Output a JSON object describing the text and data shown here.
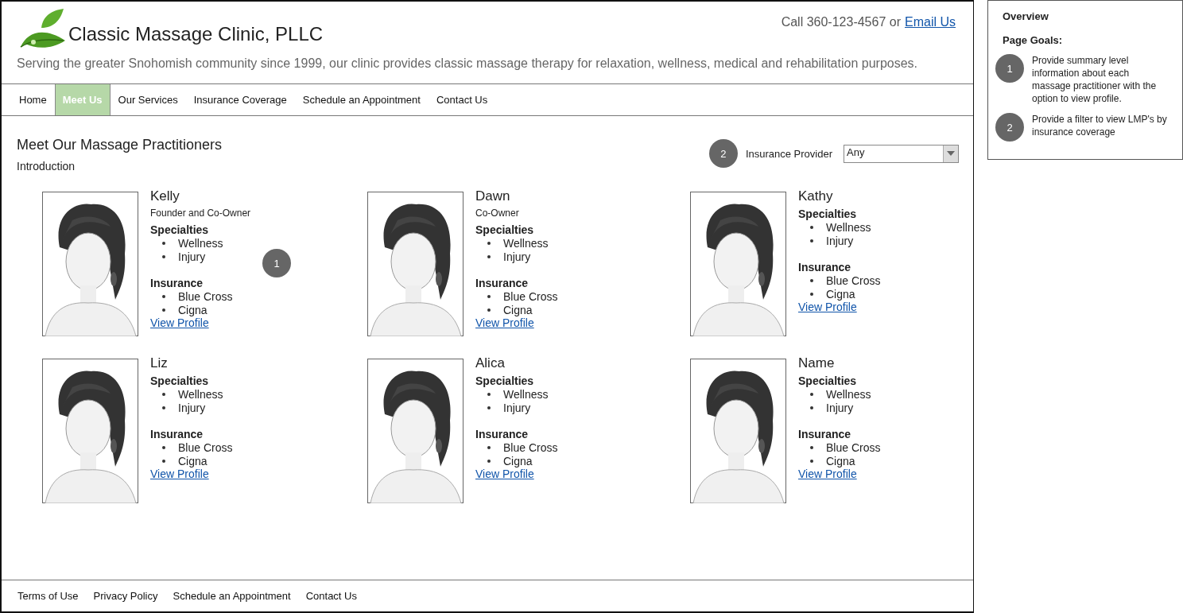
{
  "header": {
    "title": "Classic Massage Clinic, PLLC",
    "contact_text": "Call 360-123-4567 or",
    "contact_link": "Email Us",
    "tagline": "Serving the greater Snohomish community since 1999, our clinic provides classic massage therapy for relaxation, wellness, medical and rehabilitation purposes."
  },
  "nav": [
    {
      "label": "Home",
      "selected": false
    },
    {
      "label": "Meet Us",
      "selected": true
    },
    {
      "label": "Our Services",
      "selected": false
    },
    {
      "label": "Insurance Coverage",
      "selected": false
    },
    {
      "label": "Schedule an Appointment",
      "selected": false
    },
    {
      "label": "Contact Us",
      "selected": false
    }
  ],
  "content": {
    "heading": "Meet Our Massage Practitioners",
    "intro": "Introduction",
    "filter": {
      "marker": "2",
      "label": "Insurance Provider",
      "value": "Any"
    }
  },
  "practitioners": [
    {
      "name": "Kelly",
      "role": "Founder and Co-Owner",
      "marker": "1",
      "specialties_label": "Specialties",
      "specialties": [
        "Wellness",
        "Injury"
      ],
      "insurance_label": "Insurance",
      "insurance": [
        "Blue Cross",
        "Cigna"
      ],
      "link": "View Profile"
    },
    {
      "name": "Dawn",
      "role": "Co-Owner",
      "specialties_label": "Specialties",
      "specialties": [
        "Wellness",
        "Injury"
      ],
      "insurance_label": "Insurance",
      "insurance": [
        "Blue Cross",
        "Cigna"
      ],
      "link": "View Profile"
    },
    {
      "name": "Kathy",
      "specialties_label": "Specialties",
      "specialties": [
        "Wellness",
        "Injury"
      ],
      "insurance_label": "Insurance",
      "insurance": [
        "Blue Cross",
        "Cigna"
      ],
      "link": "View Profile"
    },
    {
      "name": "Liz",
      "specialties_label": "Specialties",
      "specialties": [
        "Wellness",
        "Injury"
      ],
      "insurance_label": "Insurance",
      "insurance": [
        "Blue Cross",
        "Cigna"
      ],
      "link": "View Profile"
    },
    {
      "name": "Alica",
      "specialties_label": "Specialties",
      "specialties": [
        "Wellness",
        "Injury"
      ],
      "insurance_label": "Insurance",
      "insurance": [
        "Blue Cross",
        "Cigna"
      ],
      "link": "View Profile"
    },
    {
      "name": "Name",
      "specialties_label": "Specialties",
      "specialties": [
        "Wellness",
        "Injury"
      ],
      "insurance_label": "Insurance",
      "insurance": [
        "Blue Cross",
        "Cigna"
      ],
      "link": "View Profile"
    }
  ],
  "footer": [
    "Terms of Use",
    "Privacy Policy",
    "Schedule an Appointment",
    "Contact Us"
  ],
  "overview": {
    "title": "Overview",
    "subtitle": "Page Goals:",
    "goals": [
      {
        "marker": "1",
        "text": "Provide summary level information about each massage practitioner with the option to view profile."
      },
      {
        "marker": "2",
        "text": "Provide a filter to view LMP's by insurance coverage"
      }
    ]
  }
}
